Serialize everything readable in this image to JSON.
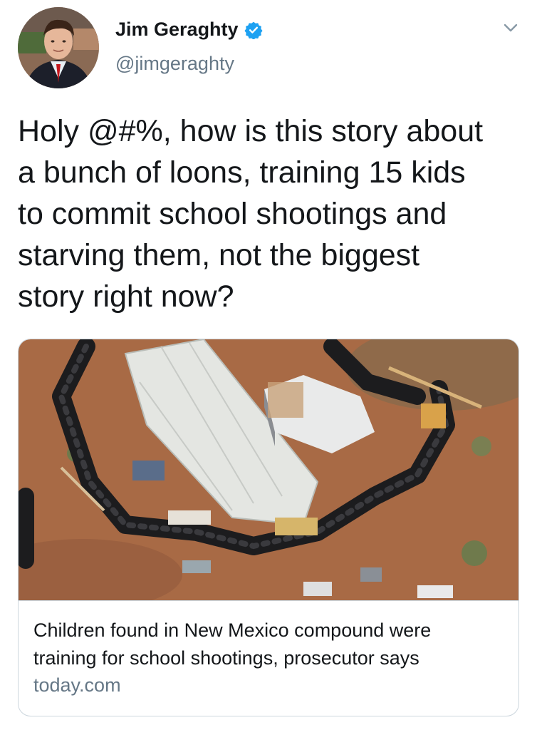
{
  "tweet": {
    "author": {
      "name": "Jim Geraghty",
      "handle": "@jimgeraghty",
      "verified": true,
      "verified_icon": "verified-badge-icon",
      "avatar": "author-avatar"
    },
    "menu_icon": "chevron-down-icon",
    "text_lines": [
      "Holy @#%, how is this story about",
      "a bunch of loons, training 15 kids",
      "to commit school shootings and",
      "starving them, not the biggest",
      "story right now?"
    ],
    "card": {
      "image": "aerial-compound-photo",
      "title_lines": [
        "Children found in New Mexico compound were",
        "training for school shootings, prosecutor says"
      ],
      "domain": "today.com"
    }
  },
  "colors": {
    "text_primary": "#14171a",
    "text_secondary": "#657786",
    "verified_blue": "#1da1f2",
    "card_border": "#ccd6dd"
  }
}
